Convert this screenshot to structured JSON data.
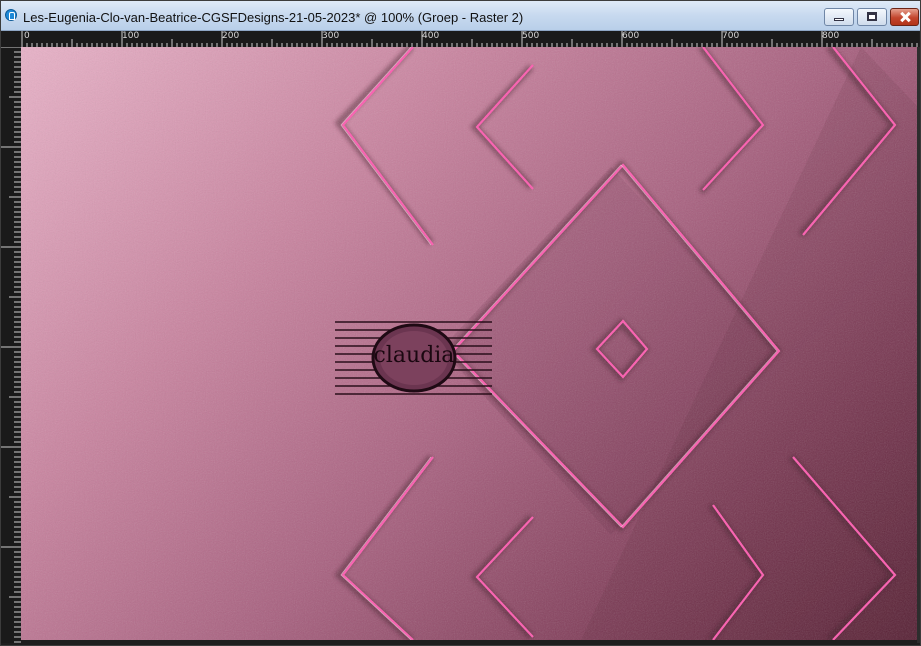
{
  "window": {
    "title": "Les-Eugenia-Clo-van-Beatrice-CGSFDesigns-21-05-2023* @ 100% (Groep - Raster 2)"
  },
  "ruler": {
    "marks": [
      "0",
      "100",
      "200",
      "300",
      "400",
      "500",
      "600",
      "700",
      "800"
    ]
  },
  "canvas": {
    "watermark_text": "claudia"
  },
  "colors": {
    "titlebar": "#c7d9ef",
    "canvas_light": "#e9b2c8",
    "canvas_dark": "#5a2136",
    "pink_line": "#ff4fa8"
  },
  "icons": [
    "app-icon",
    "minimize-icon",
    "maximize-icon",
    "close-icon"
  ]
}
